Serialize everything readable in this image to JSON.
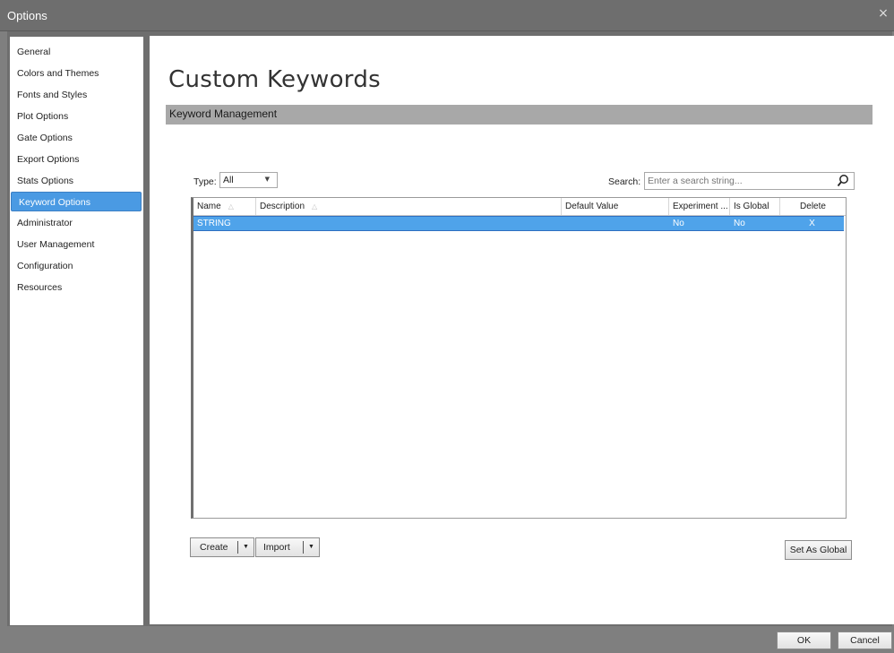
{
  "window": {
    "title": "Options",
    "close_glyph": "×"
  },
  "sidebar": {
    "items": [
      {
        "label": "General"
      },
      {
        "label": "Colors and Themes"
      },
      {
        "label": "Fonts and Styles"
      },
      {
        "label": "Plot Options"
      },
      {
        "label": "Gate Options"
      },
      {
        "label": "Export Options"
      },
      {
        "label": "Stats Options"
      },
      {
        "label": "Keyword Options",
        "selected": true
      },
      {
        "label": "Administrator"
      },
      {
        "label": "User Management"
      },
      {
        "label": "Configuration"
      },
      {
        "label": "Resources"
      }
    ]
  },
  "main": {
    "title": "Custom Keywords",
    "section": "Keyword Management",
    "type_label": "Type:",
    "type_value": "All",
    "search_label": "Search:",
    "search_placeholder": "Enter a search string...",
    "grid": {
      "columns": [
        "Name",
        "Description",
        "Default Value",
        "Experiment ...",
        "Is Global",
        "Delete"
      ],
      "rows": [
        {
          "name": "STRING",
          "description": "",
          "default_value": "",
          "experiment": "No",
          "is_global": "No",
          "delete": "X"
        }
      ]
    },
    "buttons": {
      "create": "Create",
      "import": "Import",
      "set_global": "Set As Global"
    }
  },
  "footer": {
    "ok": "OK",
    "cancel": "Cancel"
  },
  "colors": {
    "selection": "#4fa3ea",
    "nav_selected": "#4a9ae3",
    "chrome": "#6e6e6e"
  }
}
